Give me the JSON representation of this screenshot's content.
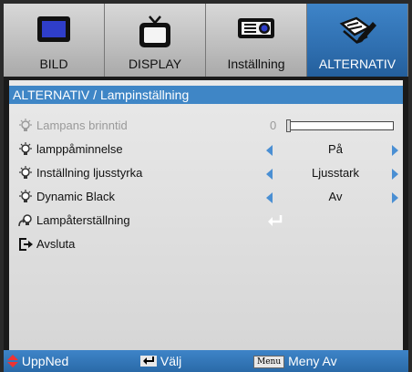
{
  "tabs": [
    {
      "label": "BILD",
      "icon": "monitor-icon",
      "active": false
    },
    {
      "label": "DISPLAY",
      "icon": "tv-icon",
      "active": false
    },
    {
      "label": "Inställning",
      "icon": "projector-icon",
      "active": false
    },
    {
      "label": "ALTERNATIV",
      "icon": "edit-pencil-icon",
      "active": true
    }
  ],
  "breadcrumb": "ALTERNATIV / Lampinställning",
  "menu": {
    "lamp_hours": {
      "label": "Lampans brinntid",
      "value": "0",
      "level": 0
    },
    "lamp_reminder": {
      "label": "lamppåminnelse",
      "value": "På"
    },
    "brightness_mode": {
      "label": "Inställning ljusstyrka",
      "value": "Ljusstark"
    },
    "dynamic_black": {
      "label": "Dynamic Black",
      "value": "Av"
    },
    "lamp_reset": {
      "label": "Lampåterställning"
    },
    "exit": {
      "label": "Avsluta"
    }
  },
  "footer": {
    "updown": "UppNed",
    "select": "Välj",
    "menu_key": "Menu",
    "menu_off": "Meny Av"
  },
  "colors": {
    "accent": "#3f86c6",
    "arrow": "#4a8fd3"
  }
}
